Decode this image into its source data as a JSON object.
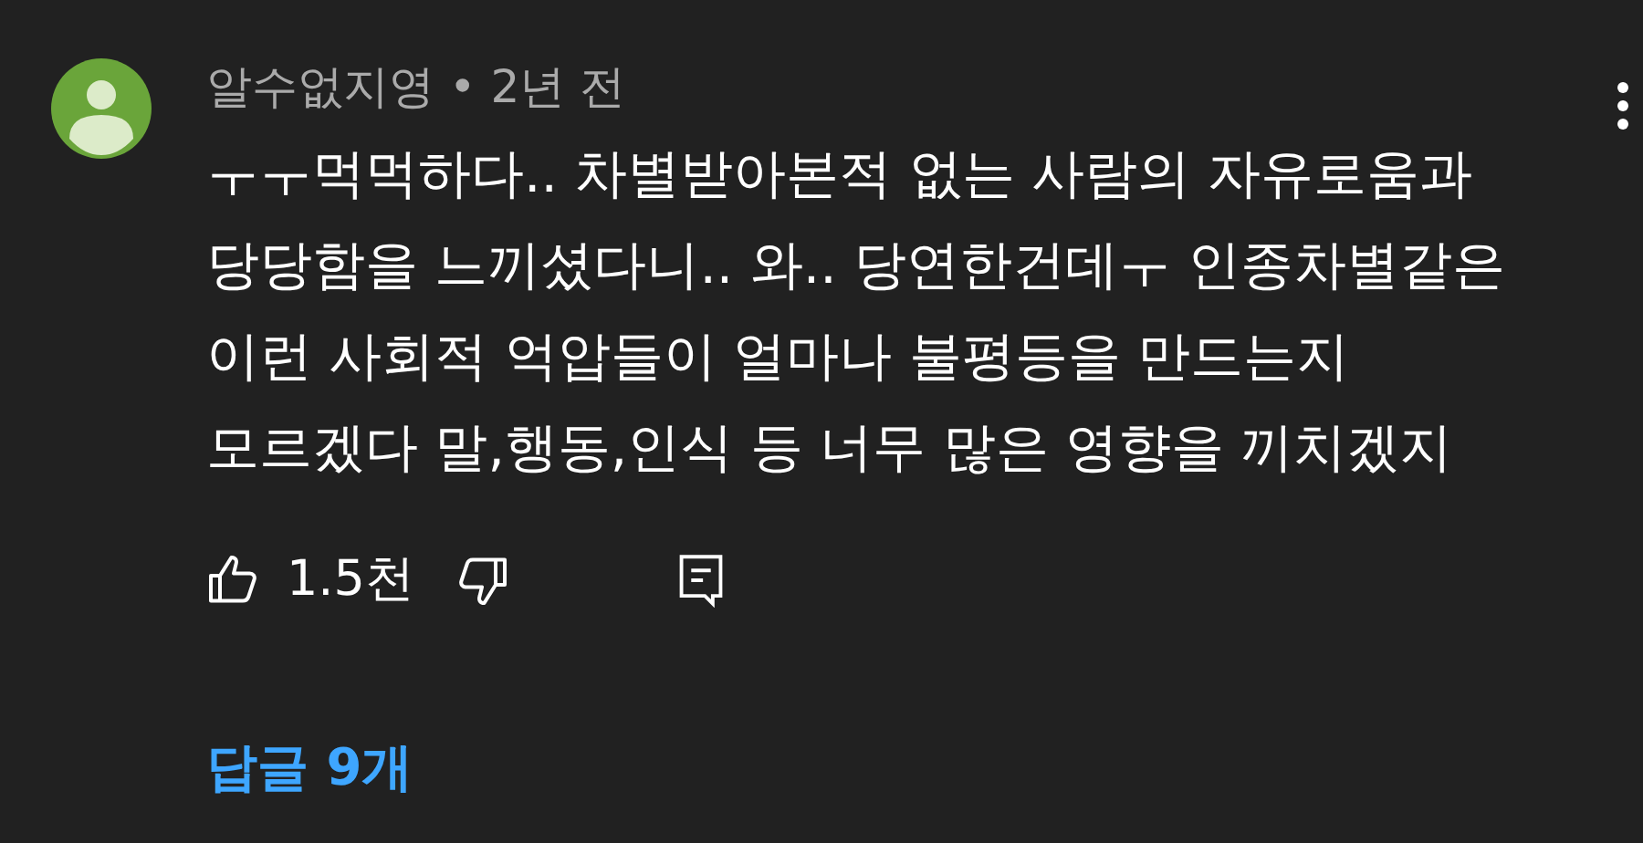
{
  "comment": {
    "author": "알수없지영",
    "separator": "•",
    "time": "2년 전",
    "lines": [
      "ㅜㅜ먹먹하다.. 차별받아본적 없는 사람의 자유로움과",
      "당당함을 느끼셨다니.. 와.. 당연한건데ㅜ 인종차별같은",
      "이런 사회적 억압들이 얼마나 불평등을 만드는지",
      "모르겠다 말,행동,인식 등 너무 많은 영향을 끼치겠지"
    ],
    "likes": "1.5천",
    "replies": "답글 9개"
  }
}
